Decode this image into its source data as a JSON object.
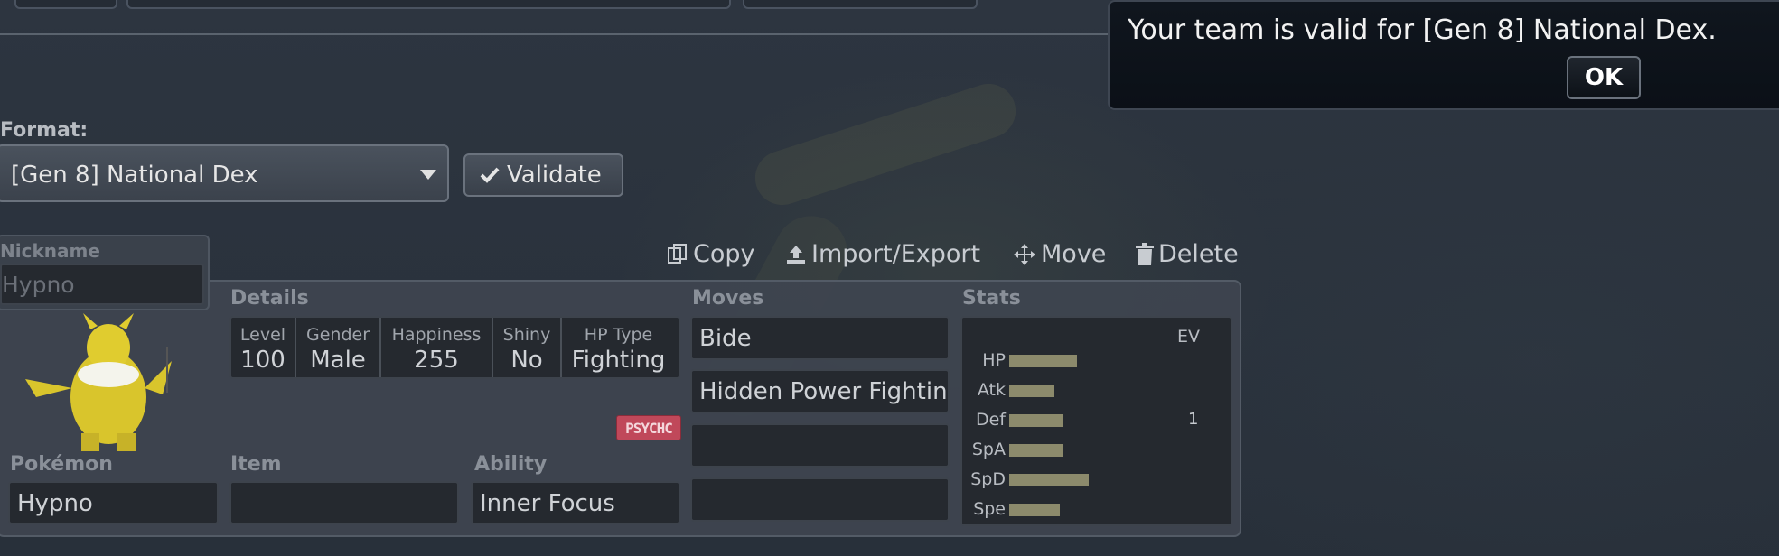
{
  "format": {
    "label": "Format:",
    "selected": "[Gen 8] National Dex",
    "validate_label": "Validate"
  },
  "actions": {
    "copy": "Copy",
    "import_export": "Import/Export",
    "move": "Move",
    "delete": "Delete"
  },
  "nickname": {
    "label": "Nickname",
    "placeholder": "Hypno"
  },
  "details": {
    "section_label": "Details",
    "columns": [
      {
        "header": "Level",
        "value": "100"
      },
      {
        "header": "Gender",
        "value": "Male"
      },
      {
        "header": "Happiness",
        "value": "255"
      },
      {
        "header": "Shiny",
        "value": "No"
      },
      {
        "header": "HP Type",
        "value": "Fighting"
      }
    ]
  },
  "type_badge": "PSYCHC",
  "pokemon": {
    "label": "Pokémon",
    "value": "Hypno"
  },
  "item": {
    "label": "Item",
    "value": ""
  },
  "ability": {
    "label": "Ability",
    "value": "Inner Focus"
  },
  "moves": {
    "label": "Moves",
    "slots": [
      "Bide",
      "Hidden Power Fighting",
      "",
      ""
    ]
  },
  "stats": {
    "label": "Stats",
    "ev_header": "EV",
    "rows": [
      {
        "name": "HP",
        "bar_fraction": 0.85,
        "ev": ""
      },
      {
        "name": "Atk",
        "bar_fraction": 0.57,
        "ev": ""
      },
      {
        "name": "Def",
        "bar_fraction": 0.67,
        "ev": "1"
      },
      {
        "name": "SpA",
        "bar_fraction": 0.68,
        "ev": ""
      },
      {
        "name": "SpD",
        "bar_fraction": 1.0,
        "ev": ""
      },
      {
        "name": "Spe",
        "bar_fraction": 0.64,
        "ev": ""
      }
    ]
  },
  "popup": {
    "message": "Your team is valid for [Gen 8] National Dex.",
    "ok_label": "OK"
  },
  "colors": {
    "stat_bar": "#8c8a6c",
    "type_badge_bg": "#c0485a",
    "popup_bg": "#0b1017"
  }
}
